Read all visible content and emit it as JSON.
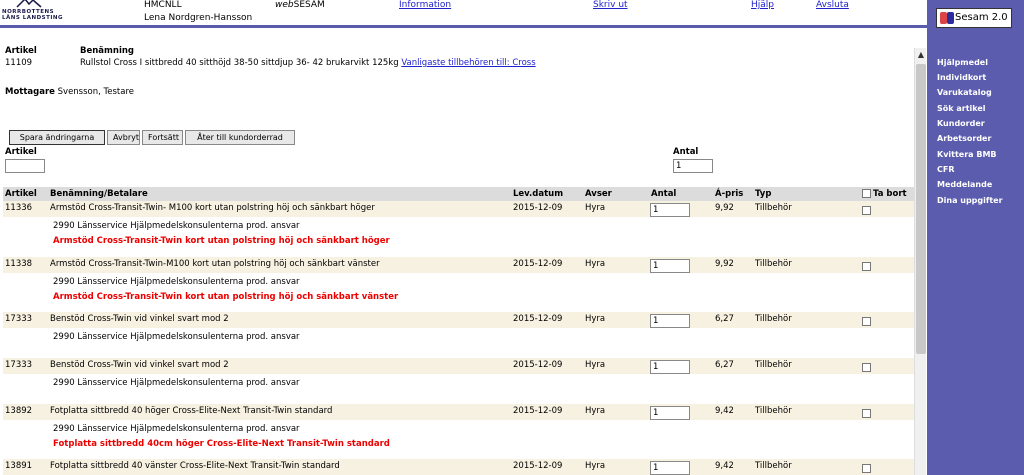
{
  "header": {
    "logo_line1": "NORRBOTTENS",
    "logo_line2": "LÄNS LANDSTING",
    "org": "HMCNLL",
    "user": "Lena Nordgren-Hansson",
    "app_name_prefix": "web",
    "app_name_suffix": "SESAM",
    "links": [
      "Information",
      "Skriv ut",
      "Hjälp",
      "Avsluta"
    ]
  },
  "sidebar": {
    "brand": "Sesam 2.0",
    "items": [
      "Hjälpmedel",
      "Individkort",
      "Varukatalog",
      "Sök artikel",
      "Kundorder",
      "Arbetsorder",
      "Kvittera BMB",
      "CFR",
      "Meddelande",
      "Dina uppgifter"
    ]
  },
  "article_info": {
    "artikel_label": "Artikel",
    "benamning_label": "Benämning",
    "artikel_value": "11109",
    "benamning_value": "Rullstol Cross I sittbredd 40 sitthöjd 38-50 sittdjup 36- 42 brukarvikt 125kg",
    "accessories_link": "Vanligaste tillbehören till: Cross"
  },
  "mottagare": {
    "label": "Mottagare",
    "value": "Svensson, Testare"
  },
  "buttons": {
    "save": "Spara ändringarna",
    "cancel": "Avbryt",
    "continue": "Fortsätt",
    "back": "Åter till kundorderrad"
  },
  "add_form": {
    "artikel_label": "Artikel",
    "artikel_value": "",
    "antal_label": "Antal",
    "antal_value": "1"
  },
  "table": {
    "headers": [
      "Artikel",
      "Benämning/Betalare",
      "Lev.datum",
      "Avser",
      "Antal",
      "Á-pris",
      "Typ",
      "Ta bort"
    ],
    "rows": [
      {
        "artikel": "11336",
        "benamning": "Armstöd Cross-Transit-Twin- M100 kort utan polstring höj och sänkbart höger",
        "levdatum": "2015-12-09",
        "avser": "Hyra",
        "antal": "1",
        "apris": "9,92",
        "typ": "Tillbehör",
        "payer": "2990 Länsservice Hjälpmedelskonsulenterna prod. ansvar",
        "note": "Armstöd Cross-Transit-Twin kort utan polstring höj och sänkbart höger"
      },
      {
        "artikel": "11338",
        "benamning": "Armstöd Cross-Transit-Twin-M100 kort utan polstring höj och sänkbart vänster",
        "levdatum": "2015-12-09",
        "avser": "Hyra",
        "antal": "1",
        "apris": "9,92",
        "typ": "Tillbehör",
        "payer": "2990 Länsservice Hjälpmedelskonsulenterna prod. ansvar",
        "note": "Armstöd Cross-Transit-Twin kort utan polstring höj och sänkbart vänster"
      },
      {
        "artikel": "17333",
        "benamning": "Benstöd Cross-Twin vid vinkel svart mod 2",
        "levdatum": "2015-12-09",
        "avser": "Hyra",
        "antal": "1",
        "apris": "6,27",
        "typ": "Tillbehör",
        "payer": "2990 Länsservice Hjälpmedelskonsulenterna prod. ansvar",
        "note": ""
      },
      {
        "artikel": "17333",
        "benamning": "Benstöd Cross-Twin vid vinkel svart mod 2",
        "levdatum": "2015-12-09",
        "avser": "Hyra",
        "antal": "1",
        "apris": "6,27",
        "typ": "Tillbehör",
        "payer": "2990 Länsservice Hjälpmedelskonsulenterna prod. ansvar",
        "note": ""
      },
      {
        "artikel": "13892",
        "benamning": "Fotplatta sittbredd 40 höger Cross-Elite-Next Transit-Twin standard",
        "levdatum": "2015-12-09",
        "avser": "Hyra",
        "antal": "1",
        "apris": "9,42",
        "typ": "Tillbehör",
        "payer": "2990 Länsservice Hjälpmedelskonsulenterna prod. ansvar",
        "note": "Fotplatta sittbredd 40cm höger Cross-Elite-Next Transit-Twin standard"
      },
      {
        "artikel": "13891",
        "benamning": "Fotplatta sittbredd 40 vänster Cross-Elite-Next Transit-Twin standard",
        "levdatum": "2015-12-09",
        "avser": "Hyra",
        "antal": "1",
        "apris": "9,42",
        "typ": "Tillbehör",
        "payer": "",
        "note": ""
      }
    ]
  },
  "colors": {
    "accent": "#5c5cae",
    "row_bg": "#f7f1e1",
    "header_bg": "#dcdcdc",
    "note_red": "#e00000",
    "link": "#2222cc"
  }
}
